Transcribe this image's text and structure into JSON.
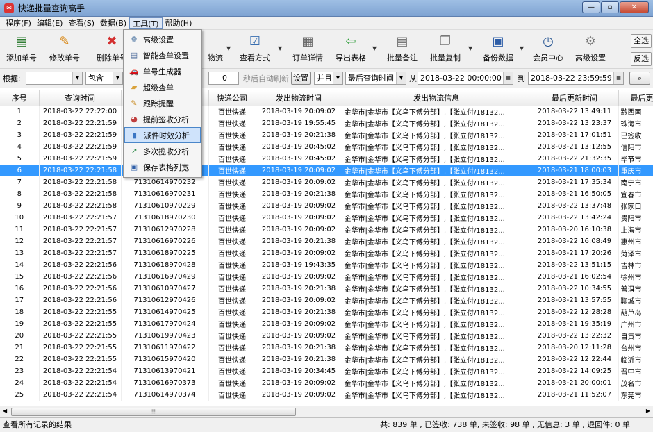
{
  "window": {
    "title": "快递批量查询高手"
  },
  "menubar": [
    "程序(F)",
    "编辑(E)",
    "查看(S)",
    "数据(B)",
    "工具(T)",
    "帮助(H)"
  ],
  "toolbar": {
    "add": "添加单号",
    "edit": "修改单号",
    "delete": "删除单号",
    "logistics": "物流",
    "query_mode": "查看方式",
    "order_detail": "订单详情",
    "export": "导出表格",
    "batch_note": "批量备注",
    "batch_copy": "批量复制",
    "backup": "备份数据",
    "member": "会员中心",
    "advanced": "高级设置",
    "select_all": "全选",
    "invert": "反选"
  },
  "filter": {
    "based_label": "根据:",
    "based_value": "",
    "contains": "包含",
    "seconds": "0",
    "auto_refresh": "秒后自动刷新",
    "settings": "设置",
    "and": "并且",
    "field": "最后查询时间",
    "from_label": "从",
    "from": "2018-03-22 00:00:00",
    "to_label": "到",
    "to": "2018-03-22 23:59:59"
  },
  "tools_menu": [
    {
      "icon": "gear-icon",
      "glyph": "⚙",
      "color": "#5a7fa8",
      "label": "高级设置"
    },
    {
      "icon": "smart-check-icon",
      "glyph": "▤",
      "color": "#4f6d9c",
      "label": "智能查单设置"
    },
    {
      "icon": "car-icon",
      "glyph": "🚗",
      "color": "#2b6cb0",
      "label": "单号生成器"
    },
    {
      "icon": "folder-icon",
      "glyph": "▰",
      "color": "#d9a23b",
      "label": "超级查单"
    },
    {
      "icon": "bell-icon",
      "glyph": "✎",
      "color": "#c88a20",
      "label": "跟踪提醒"
    },
    {
      "icon": "chart-multi-icon",
      "glyph": "◕",
      "color": "#c03f3f",
      "label": "提前签收分析"
    },
    {
      "icon": "bar-chart-icon",
      "glyph": "▮",
      "color": "#3a76c4",
      "label": "派件时效分析"
    },
    {
      "icon": "line-chart-icon",
      "glyph": "↗",
      "color": "#2d8a4a",
      "label": "多次揽收分析"
    },
    {
      "icon": "save-icon",
      "glyph": "▣",
      "color": "#2f5fa8",
      "label": "保存表格列宽"
    }
  ],
  "table": {
    "headers": [
      "序号",
      "查询时间",
      "",
      "快递公司",
      "发出物流时间",
      "发出物流信息",
      "最后更新时间",
      "最后更"
    ],
    "rows": [
      [
        "1",
        "2018-03-22 22:22:00",
        "",
        "百世快递",
        "2018-03-19 20:09:02",
        "金华市|金华市【义乌下傅分部】,【张立付/18132...",
        "2018-03-22 13:49:11",
        "黔西南"
      ],
      [
        "2",
        "2018-03-22 22:21:59",
        "",
        "百世快递",
        "2018-03-19 19:55:45",
        "金华市|金华市【义乌下傅分部】,【张立付/18132...",
        "2018-03-22 13:23:37",
        "珠海市"
      ],
      [
        "3",
        "2018-03-22 22:21:59",
        "",
        "百世快递",
        "2018-03-19 20:21:38",
        "金华市|金华市【义乌下傅分部】,【张立付/18132...",
        "2018-03-21 17:01:51",
        "已签收"
      ],
      [
        "4",
        "2018-03-22 22:21:59",
        "",
        "百世快递",
        "2018-03-19 20:45:02",
        "金华市|金华市【义乌下傅分部】,【张立付/18132...",
        "2018-03-21 13:12:55",
        "信阳市"
      ],
      [
        "5",
        "2018-03-22 22:21:59",
        "",
        "百世快递",
        "2018-03-19 20:45:02",
        "金华市|金华市【义乌下傅分部】,【张立付/18132...",
        "2018-03-22 21:32:35",
        "毕节市"
      ],
      [
        "6",
        "2018-03-22 22:21:58",
        "",
        "百世快递",
        "2018-03-19 20:09:02",
        "金华市|金华市【义乌下傅分部】,【张立付/18132...",
        "2018-03-21 18:00:03",
        "重庆市"
      ],
      [
        "7",
        "2018-03-22 22:21:58",
        "71310614970232",
        "百世快递",
        "2018-03-19 20:09:02",
        "金华市|金华市【义乌下傅分部】,【张立付/18132...",
        "2018-03-21 17:35:34",
        "南宁市"
      ],
      [
        "8",
        "2018-03-22 22:21:58",
        "71310616970231",
        "百世快递",
        "2018-03-19 20:21:38",
        "金华市|金华市【义乌下傅分部】,【张立付/18132...",
        "2018-03-21 16:50:05",
        "宜春市"
      ],
      [
        "9",
        "2018-03-22 22:21:58",
        "71310610970229",
        "百世快递",
        "2018-03-19 20:09:02",
        "金华市|金华市【义乌下傅分部】,【张立付/18132...",
        "2018-03-22 13:37:48",
        "张家口"
      ],
      [
        "10",
        "2018-03-22 22:21:57",
        "71310618970230",
        "百世快递",
        "2018-03-19 20:09:02",
        "金华市|金华市【义乌下傅分部】,【张立付/18132...",
        "2018-03-22 13:42:24",
        "贵阳市"
      ],
      [
        "11",
        "2018-03-22 22:21:57",
        "71310612970228",
        "百世快递",
        "2018-03-19 20:09:02",
        "金华市|金华市【义乌下傅分部】,【张立付/18132...",
        "2018-03-20 16:10:38",
        "上海市"
      ],
      [
        "12",
        "2018-03-22 22:21:57",
        "71310616970226",
        "百世快递",
        "2018-03-19 20:21:38",
        "金华市|金华市【义乌下傅分部】,【张立付/18132...",
        "2018-03-22 16:08:49",
        "惠州市"
      ],
      [
        "13",
        "2018-03-22 22:21:57",
        "71310618970225",
        "百世快递",
        "2018-03-19 20:09:02",
        "金华市|金华市【义乌下傅分部】,【张立付/18132...",
        "2018-03-21 17:20:26",
        "菏泽市"
      ],
      [
        "14",
        "2018-03-22 22:21:56",
        "71310618970428",
        "百世快递",
        "2018-03-19 19:43:35",
        "金华市|金华市【义乌下傅分部】,【张立付/18132...",
        "2018-03-22 13:51:15",
        "吉林市"
      ],
      [
        "15",
        "2018-03-22 22:21:56",
        "71310616970429",
        "百世快递",
        "2018-03-19 20:09:02",
        "金华市|金华市【义乌下傅分部】,【张立付/18132...",
        "2018-03-21 16:02:54",
        "徐州市"
      ],
      [
        "16",
        "2018-03-22 22:21:56",
        "71310610970427",
        "百世快递",
        "2018-03-19 20:21:38",
        "金华市|金华市【义乌下傅分部】,【张立付/18132...",
        "2018-03-22 10:34:55",
        "普洱市"
      ],
      [
        "17",
        "2018-03-22 22:21:56",
        "71310612970426",
        "百世快递",
        "2018-03-19 20:09:02",
        "金华市|金华市【义乌下傅分部】,【张立付/18132...",
        "2018-03-21 13:57:55",
        "聊城市"
      ],
      [
        "18",
        "2018-03-22 22:21:55",
        "71310614970425",
        "百世快递",
        "2018-03-19 20:21:38",
        "金华市|金华市【义乌下傅分部】,【张立付/18132...",
        "2018-03-22 12:28:28",
        "葫芦岛"
      ],
      [
        "19",
        "2018-03-22 22:21:55",
        "71310617970424",
        "百世快递",
        "2018-03-19 20:09:02",
        "金华市|金华市【义乌下傅分部】,【张立付/18132...",
        "2018-03-21 19:35:19",
        "广州市"
      ],
      [
        "20",
        "2018-03-22 22:21:55",
        "71310619970423",
        "百世快递",
        "2018-03-19 20:09:02",
        "金华市|金华市【义乌下傅分部】,【张立付/18132...",
        "2018-03-22 13:22:32",
        "自贡市"
      ],
      [
        "21",
        "2018-03-22 22:21:55",
        "71310611970422",
        "百世快递",
        "2018-03-19 20:21:38",
        "金华市|金华市【义乌下傅分部】,【张立付/18132...",
        "2018-03-20 12:11:28",
        "台州市"
      ],
      [
        "22",
        "2018-03-22 22:21:55",
        "71310615970420",
        "百世快递",
        "2018-03-19 20:21:38",
        "金华市|金华市【义乌下傅分部】,【张立付/18132...",
        "2018-03-22 12:22:44",
        "临沂市"
      ],
      [
        "23",
        "2018-03-22 22:21:54",
        "71310613970421",
        "百世快递",
        "2018-03-19 20:34:45",
        "金华市|金华市【义乌下傅分部】,【张立付/18132...",
        "2018-03-22 14:09:25",
        "晋中市"
      ],
      [
        "24",
        "2018-03-22 22:21:54",
        "71310616970373",
        "百世快递",
        "2018-03-19 20:09:02",
        "金华市|金华市【义乌下傅分部】,【张立付/18132...",
        "2018-03-21 20:00:01",
        "茂名市"
      ],
      [
        "25",
        "2018-03-22 22:21:54",
        "71310614970374",
        "百世快递",
        "2018-03-19 20:09:02",
        "金华市|金华市【义乌下傅分部】,【张立付/18132...",
        "2018-03-21 11:52:07",
        "东莞市"
      ]
    ],
    "selected_row": 6
  },
  "status": {
    "left": "查看所有记录的结果",
    "right": "共: 839 单 , 已签收: 738 单, 未签收: 98 单 , 无信息: 3 单 , 退回件: 0 单"
  }
}
